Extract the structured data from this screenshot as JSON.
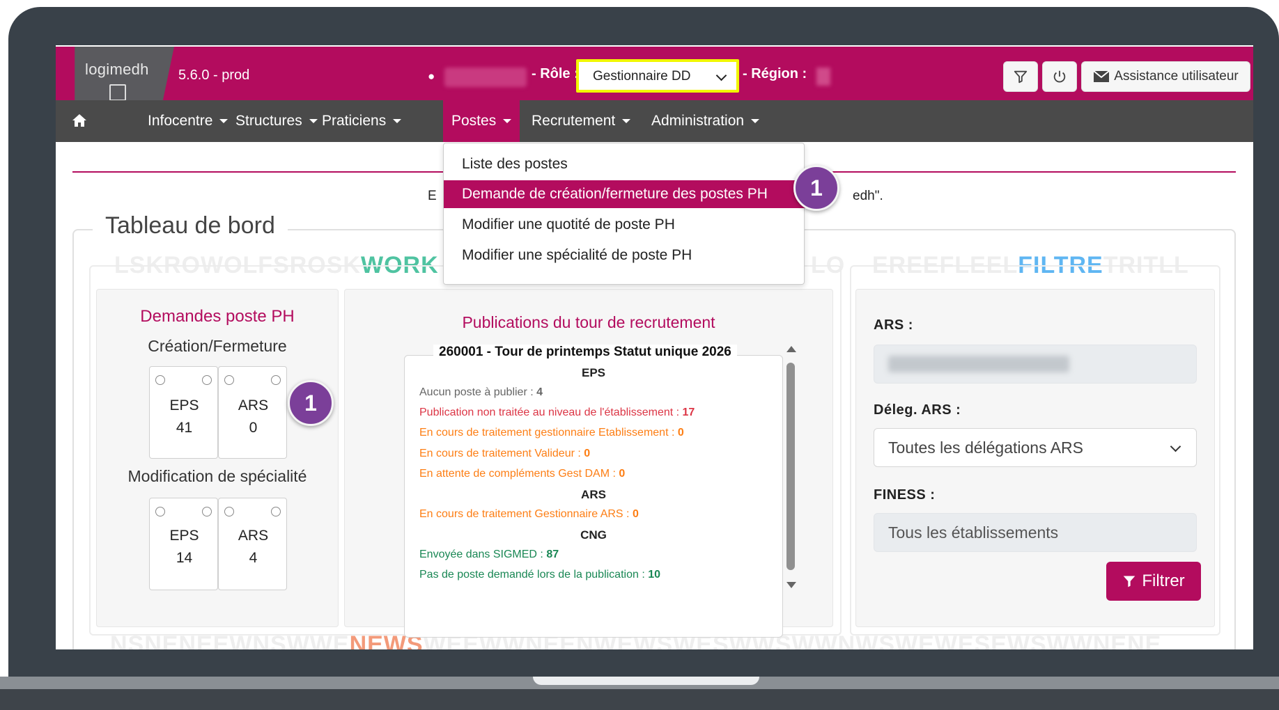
{
  "header": {
    "logo": "logimedh",
    "version": "5.6.0 - prod",
    "role_label": "- Rôle :",
    "role_value": "Gestionnaire DD",
    "region_label": "- Région :",
    "assist_label": "Assistance utilisateur"
  },
  "nav": {
    "items": [
      "Infocentre",
      "Structures",
      "Praticiens",
      "Postes",
      "Recrutement",
      "Administration"
    ],
    "active": "Postes"
  },
  "dropdown": {
    "items": [
      "Liste des postes",
      "Demande de création/fermeture des postes PH",
      "Modifier une quotité de poste PH",
      "Modifier une spécialité de poste PH"
    ],
    "active_index": 1
  },
  "notice": {
    "left_fragment": "E",
    "right_fragment": "edh\"."
  },
  "badges": [
    "1",
    "1"
  ],
  "dashboard": {
    "title": "Tableau de bord",
    "watermarks": {
      "workflow_a": "LSKROWOLFSROSK",
      "workflow_b": "WORK",
      "workflow_c": "LO",
      "filtre_a": "EREEFLEEL",
      "filtre_b": "FILTRE",
      "filtre_c": "TRITLL",
      "news_a": "NSNENEEWNSWWE",
      "news_b": "NEWS",
      "news_c": "WEEWWNEENWEWSWESWWSWWNWSWEWESEWSWWNENE"
    },
    "demandes": {
      "title": "Demandes poste PH",
      "creation_title": "Création/Fermeture",
      "creation_cards": [
        {
          "label": "EPS",
          "value": "41"
        },
        {
          "label": "ARS",
          "value": "0"
        }
      ],
      "modification_title": "Modification de spécialité",
      "modification_cards": [
        {
          "label": "EPS",
          "value": "14"
        },
        {
          "label": "ARS",
          "value": "4"
        }
      ]
    },
    "publications": {
      "title": "Publications du tour de recrutement",
      "tour": "260001 - Tour de printemps Statut unique 2026",
      "eps_header": "EPS",
      "lines_eps": [
        {
          "text": "Aucun poste à publier : ",
          "value": "4"
        },
        {
          "text": "Publication non traitée au niveau de l'établissement : ",
          "value": "17"
        },
        {
          "text": "En cours de traitement gestionnaire Etablissement : ",
          "value": "0"
        },
        {
          "text": "En cours de traitement Valideur : ",
          "value": "0"
        },
        {
          "text": "En attente de compléments Gest DAM : ",
          "value": "0"
        }
      ],
      "ars_header": "ARS",
      "lines_ars": [
        {
          "text": "En cours de traitement Gestionnaire ARS : ",
          "value": "0"
        }
      ],
      "cng_header": "CNG",
      "lines_cng": [
        {
          "text": "Envoyée dans SIGMED : ",
          "value": "87"
        },
        {
          "text": "Pas de poste demandé lors de la publication : ",
          "value": "10"
        }
      ]
    },
    "filters": {
      "ars_label": "ARS :",
      "deleg_label": "Déleg. ARS :",
      "deleg_value": "Toutes les délégations ARS",
      "finess_label": "FINESS :",
      "finess_value": "Tous les établissements",
      "button": "Filtrer"
    }
  },
  "colors": {
    "brand": "#b30c5e",
    "navbar": "#4a4a4a",
    "badge": "#7b3f99",
    "highlight": "#f1f600"
  }
}
